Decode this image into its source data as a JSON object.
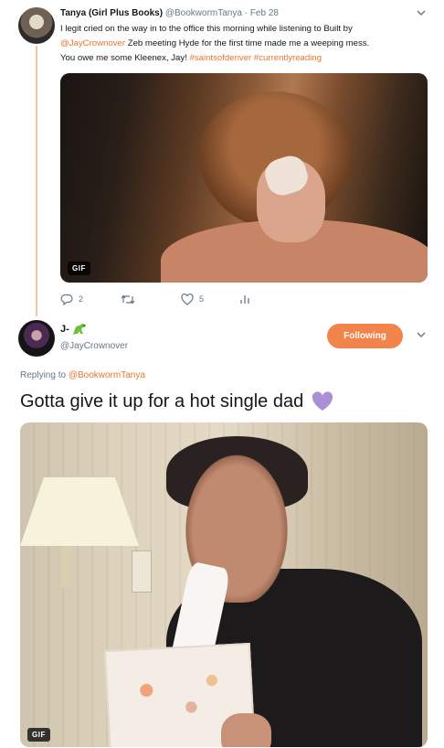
{
  "tweet1": {
    "display_name": "Tanya (Girl Plus Books)",
    "handle": "@BookwormTanya",
    "separator": "·",
    "date": "Feb 28",
    "text_line1": "I legit cried on the way in to the office this morning while listening to Built by",
    "mention": "@JayCrownover",
    "text_line2": " Zeb meeting Hyde for the first time made me a weeping mess.",
    "text_line3": "You owe me some Kleenex, Jay! ",
    "hashtag1": "#saintsofdenver",
    "hashtag2": "#currentlyreading",
    "gif_badge": "GIF",
    "reply_count": "2",
    "like_count": "5"
  },
  "tweet2": {
    "display_name": "J-",
    "handle": "@JayCrownover",
    "follow_button": "Following",
    "replying_to_label": "Replying to ",
    "replying_to_handle": "@BookwormTanya",
    "text": "Gotta give it up for a hot single dad",
    "gif_badge": "GIF"
  },
  "colors": {
    "accent": "#f2834a",
    "link": "#e8752f",
    "thread_line": "#f7c2a2",
    "muted": "#657786",
    "heart_emoji": "#a98fd6"
  },
  "icons": [
    "chevron-down-icon",
    "reply-icon",
    "retweet-icon",
    "like-icon",
    "analytics-icon",
    "dinosaur-emoji-icon",
    "purple-heart-emoji-icon"
  ]
}
